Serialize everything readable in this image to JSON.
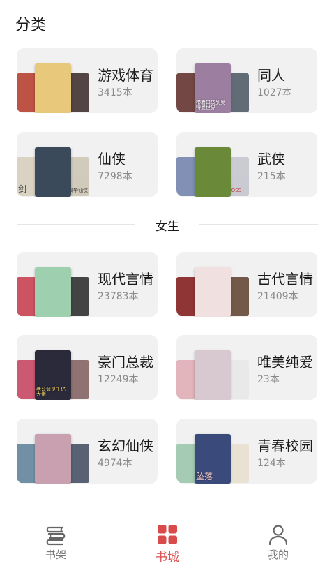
{
  "header": {
    "title": "分类"
  },
  "accent_color": "#d94a4a",
  "male_categories": [
    {
      "name": "游戏体育",
      "count": "3415本",
      "covers": [
        {
          "color": "#b84a3a",
          "text": ""
        },
        {
          "color": "#e8c87a",
          "text": ""
        },
        {
          "color": "#4a3b3a",
          "text": ""
        }
      ]
    },
    {
      "name": "同人",
      "count": "1027本",
      "covers": [
        {
          "color": "#6b3e3a",
          "text": ""
        },
        {
          "color": "#9c7fa0",
          "text": "带着口袋到奥特曼世界"
        },
        {
          "color": "#5a6470",
          "text": ""
        }
      ]
    },
    {
      "name": "仙侠",
      "count": "7298本",
      "covers": [
        {
          "color": "#d8d0c0",
          "text": "剑"
        },
        {
          "color": "#3a4a5a",
          "text": ""
        },
        {
          "color": "#cfc8b8",
          "text": "风华仙侠"
        }
      ]
    },
    {
      "name": "武侠",
      "count": "215本",
      "covers": [
        {
          "color": "#7a8ab0",
          "text": ""
        },
        {
          "color": "#6a8a3a",
          "text": ""
        },
        {
          "color": "#c8c8d0",
          "text": "BOSS"
        }
      ]
    }
  ],
  "divider": {
    "label": "女生"
  },
  "female_categories": [
    {
      "name": "现代言情",
      "count": "23783本",
      "covers": [
        {
          "color": "#c84a5a",
          "text": ""
        },
        {
          "color": "#9ed0b0",
          "text": ""
        },
        {
          "color": "#3a3a3a",
          "text": ""
        }
      ]
    },
    {
      "name": "古代言情",
      "count": "21409本",
      "covers": [
        {
          "color": "#8a2a2a",
          "text": ""
        },
        {
          "color": "#f0e0e0",
          "text": ""
        },
        {
          "color": "#6a5040",
          "text": ""
        }
      ]
    },
    {
      "name": "豪门总裁",
      "count": "12249本",
      "covers": [
        {
          "color": "#c8506a",
          "text": ""
        },
        {
          "color": "#2a2a3a",
          "text": "老公竟是千亿大佬"
        },
        {
          "color": "#8a6a6a",
          "text": ""
        }
      ]
    },
    {
      "name": "唯美纯爱",
      "count": "23本",
      "covers": [
        {
          "color": "#e0b0b8",
          "text": ""
        },
        {
          "color": "#d8c8d0",
          "text": ""
        },
        {
          "color": "#e8e8e8",
          "text": ""
        }
      ]
    },
    {
      "name": "玄幻仙侠",
      "count": "4974本",
      "covers": [
        {
          "color": "#6a8aa0",
          "text": ""
        },
        {
          "color": "#c8a0b0",
          "text": ""
        },
        {
          "color": "#505a6a",
          "text": ""
        }
      ]
    },
    {
      "name": "青春校园",
      "count": "124本",
      "covers": [
        {
          "color": "#a0c8b0",
          "text": ""
        },
        {
          "color": "#3a4a7a",
          "text": "坠落"
        },
        {
          "color": "#e8e0d0",
          "text": ""
        }
      ]
    }
  ],
  "tabbar": {
    "items": [
      {
        "label": "书架",
        "icon": "bookshelf-icon"
      },
      {
        "label": "书城",
        "icon": "grid-icon"
      },
      {
        "label": "我的",
        "icon": "user-icon"
      }
    ],
    "active": 1
  }
}
